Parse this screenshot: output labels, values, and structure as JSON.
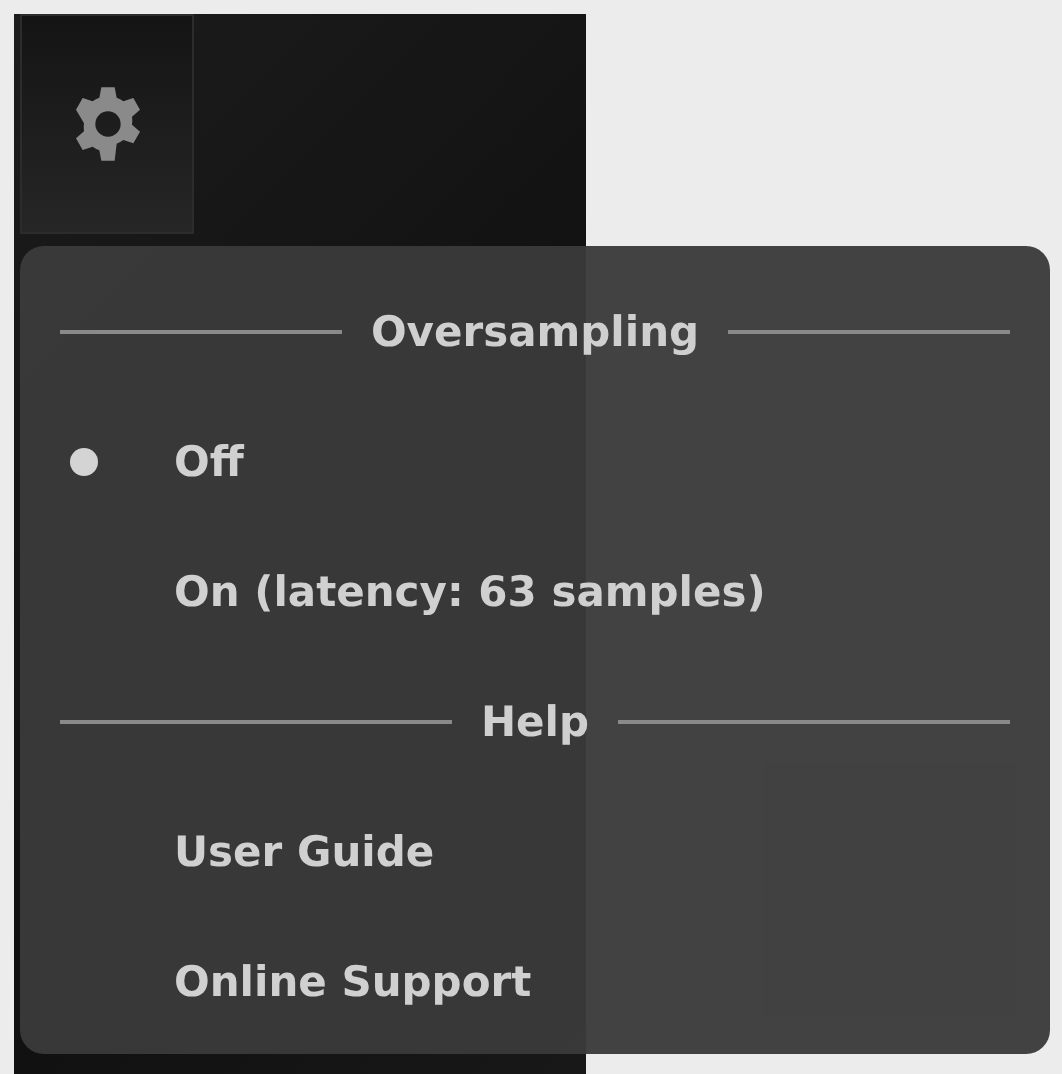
{
  "menu": {
    "sections": [
      {
        "title": "Oversampling",
        "kind": "options",
        "items": [
          {
            "label": "Off",
            "selected": true
          },
          {
            "label": "On (latency: 63 samples)",
            "selected": false
          }
        ]
      },
      {
        "title": "Help",
        "kind": "links",
        "items": [
          {
            "label": "User Guide"
          },
          {
            "label": "Online Support"
          }
        ]
      }
    ]
  }
}
